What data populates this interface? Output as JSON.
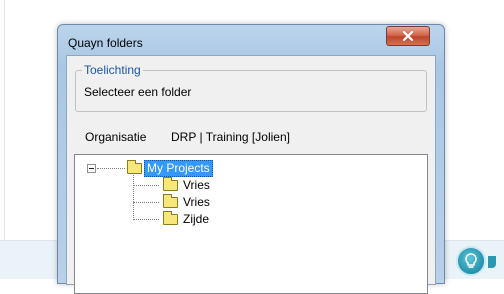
{
  "dialog": {
    "title": "Quayn folders"
  },
  "group": {
    "legend": "Toelichting",
    "text": "Selecteer een folder"
  },
  "organisation": {
    "label": "Organisatie",
    "value": "DRP | Training [Jolien]"
  },
  "tree": {
    "root": {
      "label": "My Projects",
      "selected": true,
      "expanded": true
    },
    "children": [
      {
        "label": "Vries"
      },
      {
        "label": "Vries"
      },
      {
        "label": "Zijde"
      }
    ]
  },
  "icons": {
    "close": "close-icon",
    "folder": "folder-icon",
    "help": "lightbulb-icon"
  },
  "colors": {
    "selection": "#3399ff",
    "close_button": "#c1432b",
    "legend_text": "#1b55a8"
  }
}
